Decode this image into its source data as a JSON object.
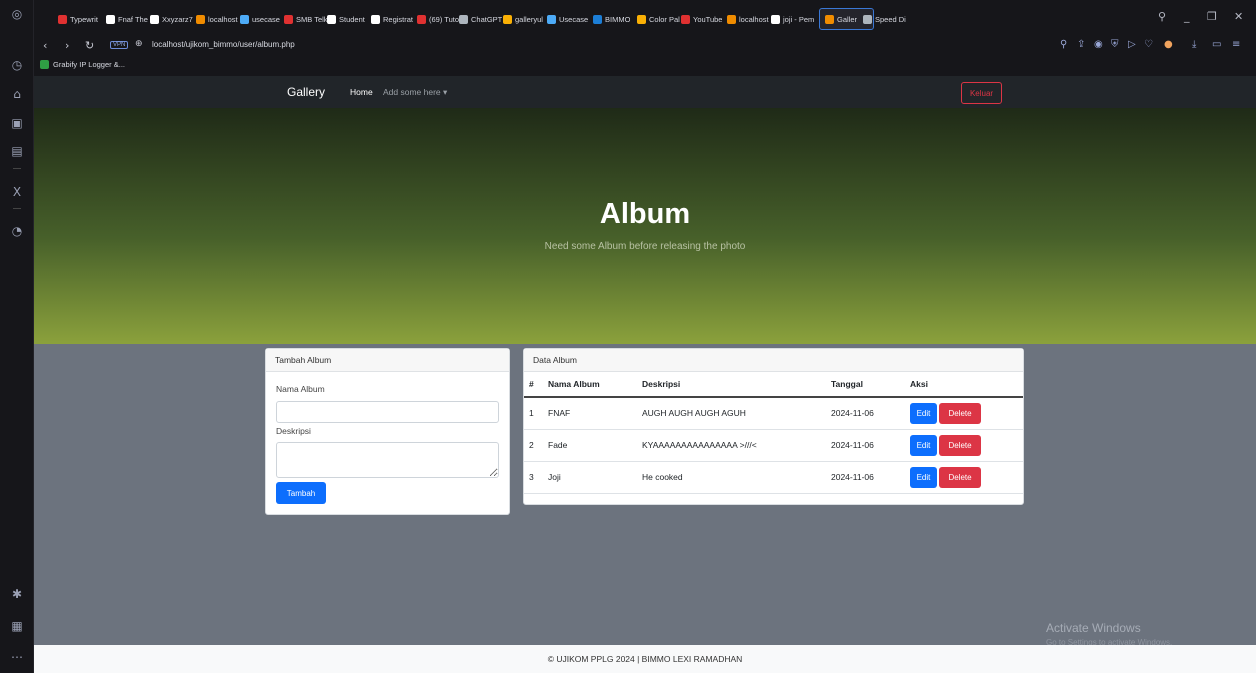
{
  "browser": {
    "tabs": [
      {
        "label": "Typewrit",
        "color": "#e03131"
      },
      {
        "label": "Fnaf The",
        "color": "#ffffff"
      },
      {
        "label": "Xxyzarz7",
        "color": "#ffffff"
      },
      {
        "label": "localhost",
        "color": "#f08c00"
      },
      {
        "label": "usecase",
        "color": "#4dabf7"
      },
      {
        "label": "SMB Telk",
        "color": "#e03131"
      },
      {
        "label": "Student",
        "color": "#ffffff"
      },
      {
        "label": "Registrat",
        "color": "#ffffff"
      },
      {
        "label": "(69) Tuto",
        "color": "#e03131"
      },
      {
        "label": "ChatGPT",
        "color": "#adb5bd"
      },
      {
        "label": "galleryul",
        "color": "#fab005"
      },
      {
        "label": "Usecase",
        "color": "#4dabf7"
      },
      {
        "label": "BIMMO",
        "color": "#1c7ed6"
      },
      {
        "label": "Color Pal",
        "color": "#fab005"
      },
      {
        "label": "YouTube",
        "color": "#e03131"
      },
      {
        "label": "localhost",
        "color": "#f08c00"
      },
      {
        "label": "joji - Pem",
        "color": "#ffffff"
      },
      {
        "label": "Galler",
        "color": "#f08c00"
      },
      {
        "label": "Speed Di",
        "color": "#adb5bd"
      }
    ],
    "url": "localhost/ujikom_bimmo/user/album.php",
    "vpn_label": "VPN",
    "bookmark": "Grabify IP Logger &..."
  },
  "navbar": {
    "brand": "Gallery",
    "home": "Home",
    "add_menu": "Add some here ▾",
    "logout": "Keluar"
  },
  "hero": {
    "title": "Album",
    "subtitle": "Need some Album before releasing the photo"
  },
  "form": {
    "header": "Tambah Album",
    "name_label": "Nama Album",
    "name_value": "",
    "desc_label": "Deskripsi",
    "desc_value": "",
    "submit": "Tambah"
  },
  "table": {
    "header": "Data Album",
    "columns": [
      "#",
      "Nama Album",
      "Deskripsi",
      "Tanggal",
      "Aksi"
    ],
    "edit_label": "Edit",
    "delete_label": "Delete",
    "rows": [
      {
        "no": "1",
        "name": "FNAF",
        "desc": "AUGH AUGH AUGH AGUH",
        "date": "2024-11-06"
      },
      {
        "no": "2",
        "name": "Fade",
        "desc": "KYAAAAAAAAAAAAAAA >///<",
        "date": "2024-11-06"
      },
      {
        "no": "3",
        "name": "Joji",
        "desc": "He cooked",
        "date": "2024-11-06"
      }
    ]
  },
  "footer": "© UJIKOM PPLG 2024 | BIMMO LEXI RAMADHAN",
  "watermark": {
    "title": "Activate Windows",
    "subtitle": "Go to Settings to activate Windows."
  }
}
